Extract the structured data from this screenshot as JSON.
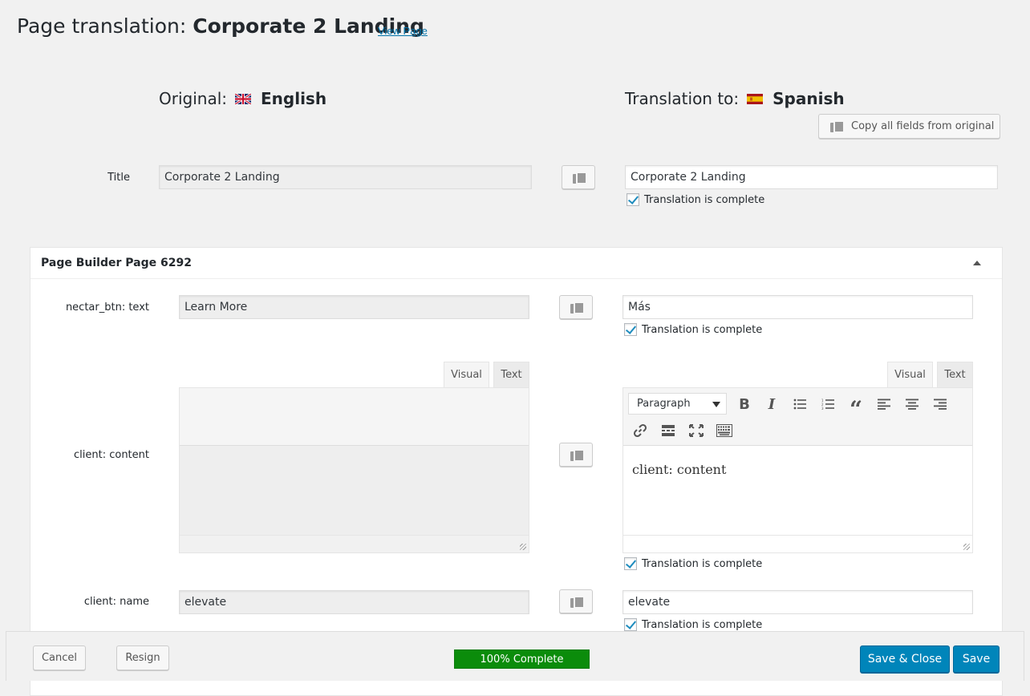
{
  "header": {
    "title_prefix": "Page translation:",
    "title_name": "Corporate 2 Landing",
    "view_link": "View Page"
  },
  "original": {
    "label": "Original:",
    "language": "English",
    "flag_icon": "uk-flag-icon"
  },
  "translation": {
    "label": "Translation to:",
    "language": "Spanish",
    "flag_icon": "spain-flag-icon"
  },
  "copy_all_label": "Copy all fields from original",
  "title_field": {
    "label": "Title",
    "original": "Corporate 2 Landing",
    "translated": "Corporate 2 Landing",
    "complete_label": "Translation is complete"
  },
  "panel": {
    "title": "Page Builder Page 6292",
    "fields": [
      {
        "label": "nectar_btn: text",
        "original": "Learn More",
        "translated": "Más",
        "complete_label": "Translation is complete"
      },
      {
        "label": "client: content",
        "original": "",
        "translated": "client: content",
        "complete_label": "Translation is complete"
      },
      {
        "label": "client: name",
        "original": "elevate",
        "translated": "elevate",
        "complete_label": "Translation is complete"
      }
    ],
    "editor": {
      "tab_visual": "Visual",
      "tab_text": "Text",
      "format_value": "Paragraph"
    }
  },
  "footer": {
    "cancel": "Cancel",
    "resign": "Resign",
    "progress": "100% Complete",
    "progress_value": 1.0,
    "save_close": "Save & Close",
    "save": "Save"
  },
  "colors": {
    "accent": "#0085ba",
    "progress": "#0b8c0b",
    "link": "#0073aa",
    "background": "#f1f1f1"
  }
}
